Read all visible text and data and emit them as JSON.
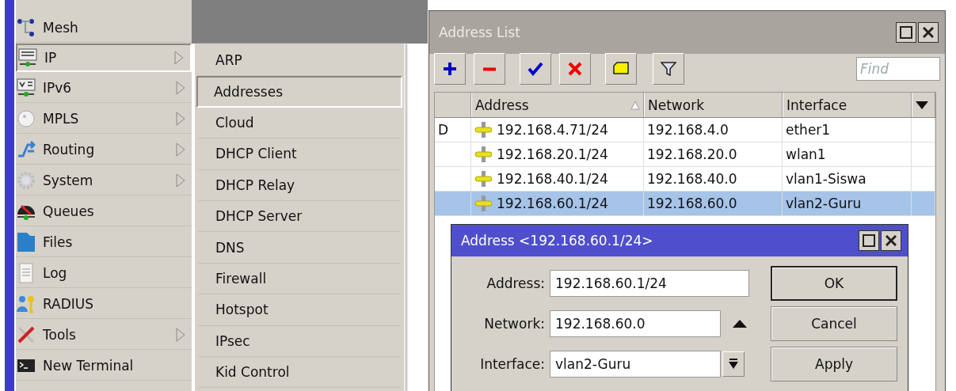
{
  "menu": {
    "items": [
      {
        "label": "Mesh",
        "submenu": false,
        "selected": false
      },
      {
        "label": "IP",
        "submenu": true,
        "selected": true
      },
      {
        "label": "IPv6",
        "submenu": true,
        "selected": false
      },
      {
        "label": "MPLS",
        "submenu": true,
        "selected": false
      },
      {
        "label": "Routing",
        "submenu": true,
        "selected": false
      },
      {
        "label": "System",
        "submenu": true,
        "selected": false
      },
      {
        "label": "Queues",
        "submenu": false,
        "selected": false
      },
      {
        "label": "Files",
        "submenu": false,
        "selected": false
      },
      {
        "label": "Log",
        "submenu": false,
        "selected": false
      },
      {
        "label": "RADIUS",
        "submenu": false,
        "selected": false
      },
      {
        "label": "Tools",
        "submenu": true,
        "selected": false
      },
      {
        "label": "New Terminal",
        "submenu": false,
        "selected": false
      }
    ]
  },
  "submenu": {
    "items": [
      {
        "label": "ARP",
        "selected": false
      },
      {
        "label": "Addresses",
        "selected": true
      },
      {
        "label": "Cloud",
        "selected": false
      },
      {
        "label": "DHCP Client",
        "selected": false
      },
      {
        "label": "DHCP Relay",
        "selected": false
      },
      {
        "label": "DHCP Server",
        "selected": false
      },
      {
        "label": "DNS",
        "selected": false
      },
      {
        "label": "Firewall",
        "selected": false
      },
      {
        "label": "Hotspot",
        "selected": false
      },
      {
        "label": "IPsec",
        "selected": false
      },
      {
        "label": "Kid Control",
        "selected": false
      }
    ]
  },
  "address_list": {
    "title": "Address List",
    "find": {
      "placeholder": "Find"
    },
    "columns": [
      {
        "label": "Address",
        "sorted": true
      },
      {
        "label": "Network",
        "sorted": false
      },
      {
        "label": "Interface",
        "sorted": false
      }
    ],
    "rows": [
      {
        "flag": "D",
        "address": "192.168.4.71/24",
        "network": "192.168.4.0",
        "interface": "ether1",
        "selected": false
      },
      {
        "address": "192.168.20.1/24",
        "network": "192.168.20.0",
        "interface": "wlan1",
        "selected": false
      },
      {
        "address": "192.168.40.1/24",
        "network": "192.168.40.0",
        "interface": "vlan1-Siswa",
        "selected": false
      },
      {
        "address": "192.168.60.1/24",
        "network": "192.168.60.0",
        "interface": "vlan2-Guru",
        "selected": true
      }
    ]
  },
  "dialog": {
    "title": "Address <192.168.60.1/24>",
    "fields": [
      {
        "kind": "text",
        "label": "Address:",
        "value": "192.168.60.1/24"
      },
      {
        "kind": "spin",
        "label": "Network:",
        "value": "192.168.60.0"
      },
      {
        "kind": "dropdown",
        "label": "Interface:",
        "value": "vlan2-Guru"
      }
    ],
    "buttons": [
      {
        "label": "OK",
        "default": true
      },
      {
        "label": "Cancel",
        "default": false
      },
      {
        "label": "Apply",
        "default": false
      }
    ]
  }
}
